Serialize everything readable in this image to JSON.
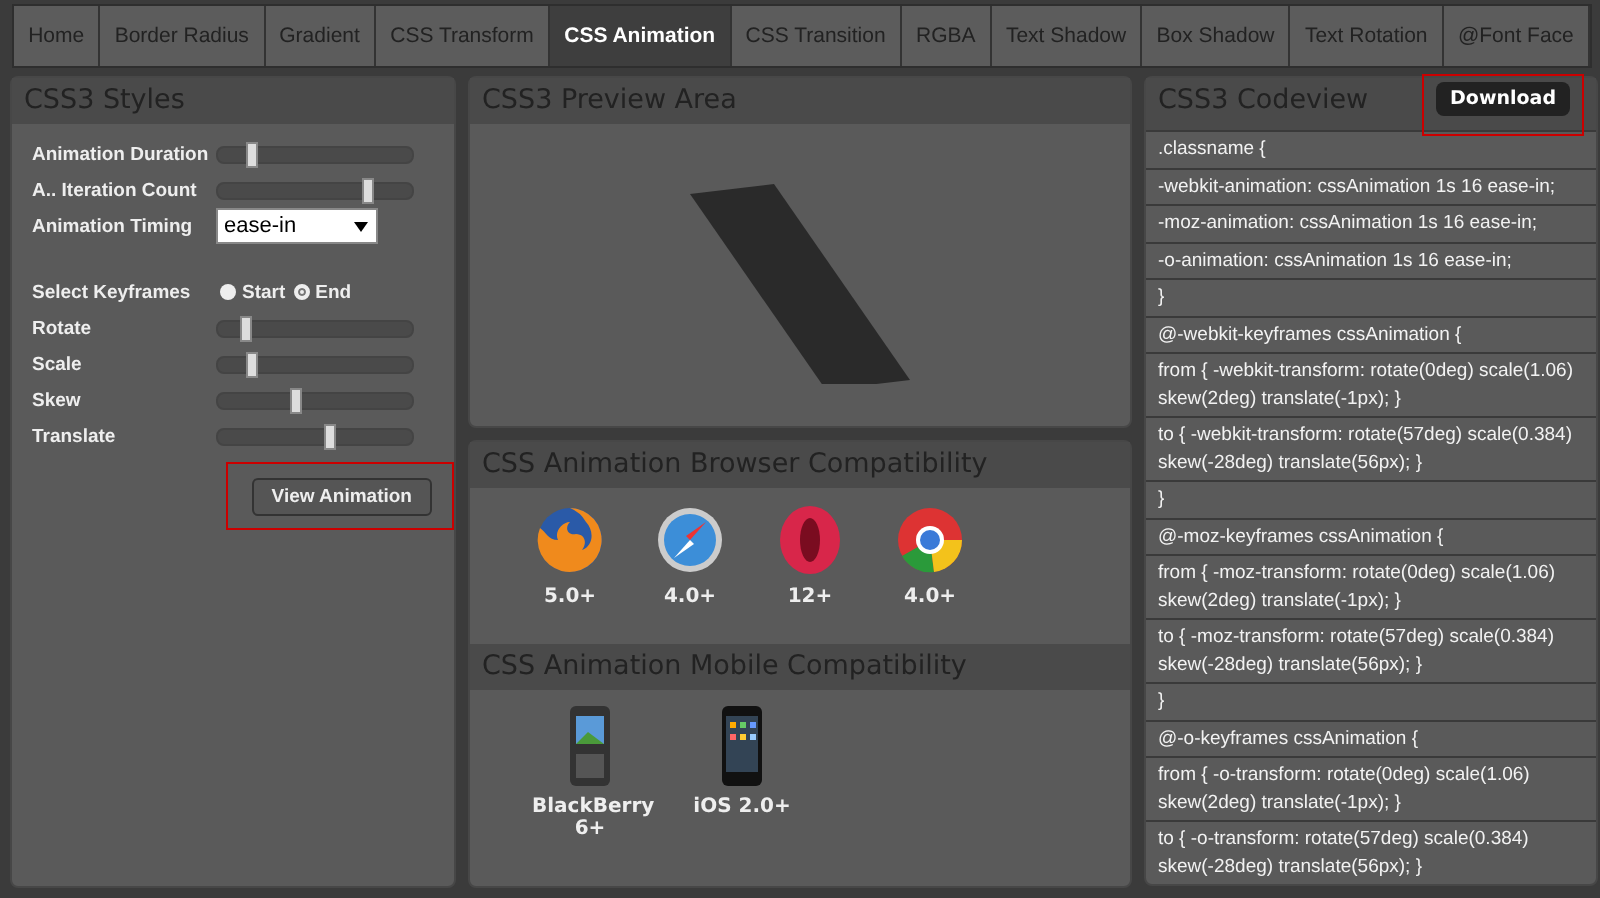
{
  "tabs": [
    {
      "label": "Home",
      "selected": false
    },
    {
      "label": "Border Radius",
      "selected": false
    },
    {
      "label": "Gradient",
      "selected": false
    },
    {
      "label": "CSS Transform",
      "selected": false
    },
    {
      "label": "CSS Animation",
      "selected": true
    },
    {
      "label": "CSS Transition",
      "selected": false
    },
    {
      "label": "RGBA",
      "selected": false
    },
    {
      "label": "Text Shadow",
      "selected": false
    },
    {
      "label": "Box Shadow",
      "selected": false
    },
    {
      "label": "Text Rotation",
      "selected": false
    },
    {
      "label": "@Font Face",
      "selected": false
    }
  ],
  "styles_panel": {
    "title": "CSS3 Styles",
    "controls": [
      {
        "kind": "slider",
        "label": "Animation Duration",
        "level": 0.18
      },
      {
        "kind": "slider",
        "label": "A.. Iteration Count",
        "level": 0.77
      },
      {
        "kind": "select",
        "label": "Animation Timing",
        "value": "ease-in"
      },
      {
        "kind": "radio",
        "label": "Select Keyframes",
        "options": [
          {
            "label": "Start",
            "selected": false
          },
          {
            "label": "End",
            "selected": true
          }
        ]
      },
      {
        "kind": "slider",
        "label": "Rotate",
        "level": 0.14
      },
      {
        "kind": "slider",
        "label": "Scale",
        "level": 0.18
      },
      {
        "kind": "slider",
        "label": "Skew",
        "level": 0.4
      },
      {
        "kind": "slider",
        "label": "Translate",
        "level": 0.58
      }
    ],
    "button": "View Animation"
  },
  "preview_panel": {
    "title": "CSS3 Preview Area"
  },
  "browser_panel": {
    "title": "CSS Animation Browser Compatibility",
    "items": [
      {
        "kind": "firefox",
        "version": "5.0+"
      },
      {
        "kind": "safari",
        "version": "4.0+"
      },
      {
        "kind": "opera",
        "version": "12+"
      },
      {
        "kind": "chrome",
        "version": "4.0+"
      }
    ]
  },
  "mobile_panel": {
    "title": "CSS Animation Mobile Compatibility",
    "items": [
      {
        "kind": "blackberry",
        "version": "BlackBerry 6+"
      },
      {
        "kind": "iphone",
        "version": "iOS 2.0+"
      }
    ]
  },
  "code_panel": {
    "title": "CSS3 Codeview",
    "button": "Download",
    "lines": [
      ".classname {",
      "-webkit-animation: cssAnimation 1s 16 ease-in;",
      "-moz-animation: cssAnimation 1s 16 ease-in;",
      "-o-animation: cssAnimation 1s 16 ease-in;",
      "}",
      "@-webkit-keyframes cssAnimation {",
      "from { -webkit-transform: rotate(0deg) scale(1.06) skew(2deg) translate(-1px); }",
      "to { -webkit-transform: rotate(57deg) scale(0.384) skew(-28deg) translate(56px); }",
      "}",
      "@-moz-keyframes cssAnimation {",
      "from { -moz-transform: rotate(0deg) scale(1.06) skew(2deg) translate(-1px); }",
      "to { -moz-transform: rotate(57deg) scale(0.384) skew(-28deg) translate(56px); }",
      "}",
      "@-o-keyframes cssAnimation {",
      "from { -o-transform: rotate(0deg) scale(1.06) skew(2deg) translate(-1px); }",
      "to { -o-transform: rotate(57deg) scale(0.384) skew(-28deg) translate(56px); }"
    ]
  }
}
